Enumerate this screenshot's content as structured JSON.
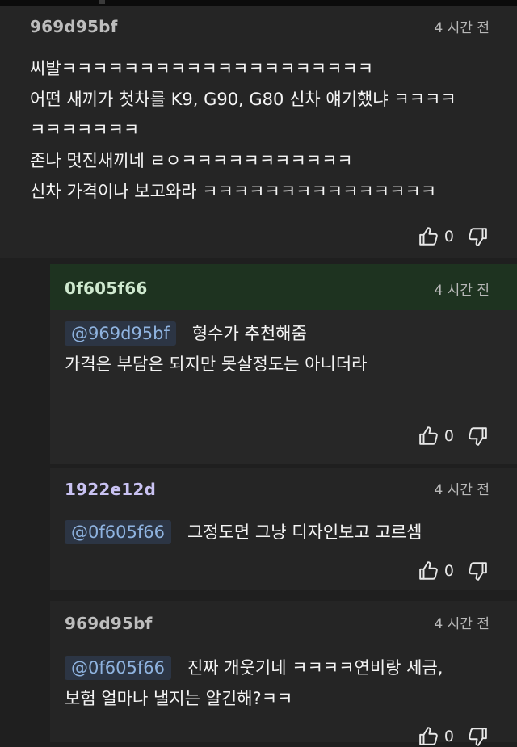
{
  "comments": [
    {
      "author": "969d95bf",
      "author_color": "#bdbdbd",
      "time": "4 시간 전",
      "lines": [
        "씨발ㅋㅋㅋㅋㅋㅋㅋㅋㅋㅋㅋㅋㅋㅋㅋㅋㅋㅋㅋㅋ",
        "어떤 새끼가 첫차를 K9, G90, G80 신차 얘기했냐 ㅋㅋㅋㅋ",
        "ㅋㅋㅋㅋㅋㅋㅋ",
        "존나 멋진새끼네 ㄹㅇㅋㅋㅋㅋㅋㅋㅋㅋㅋㅋㅋ",
        "신차 가격이나 보고와라 ㅋㅋㅋㅋㅋㅋㅋㅋㅋㅋㅋㅋㅋㅋㅋ"
      ],
      "likes": "0"
    },
    {
      "author": "0f605f66",
      "author_color": "#cfe9cf",
      "time": "4 시간 전",
      "mention": "@969d95bf",
      "lines": [
        "형수가 추천해줌",
        "가격은 부담은 되지만 못살정도는 아니더라"
      ],
      "likes": "0"
    },
    {
      "author": "1922e12d",
      "author_color": "#c9c2f2",
      "time": "4 시간 전",
      "mention": "@0f605f66",
      "lines": [
        "그정도면 그냥 디자인보고 고르셈"
      ],
      "likes": "0"
    },
    {
      "author": "969d95bf",
      "author_color": "#bdbdbd",
      "time": "4 시간 전",
      "mention": "@0f605f66",
      "lines": [
        "진짜 개웃기네 ㅋㅋㅋㅋ연비랑 세금,",
        "보험 얼마나 낼지는 알긴해?ㅋㅋ"
      ],
      "likes": "0"
    }
  ],
  "icons": {
    "like": "thumbs-up-icon",
    "dislike": "thumbs-down-icon"
  },
  "colors": {
    "background": "#1f1f1f",
    "op_reply_header": "#1e3320",
    "mention_bg": "#2c3544",
    "mention_text": "#8fb3df"
  }
}
